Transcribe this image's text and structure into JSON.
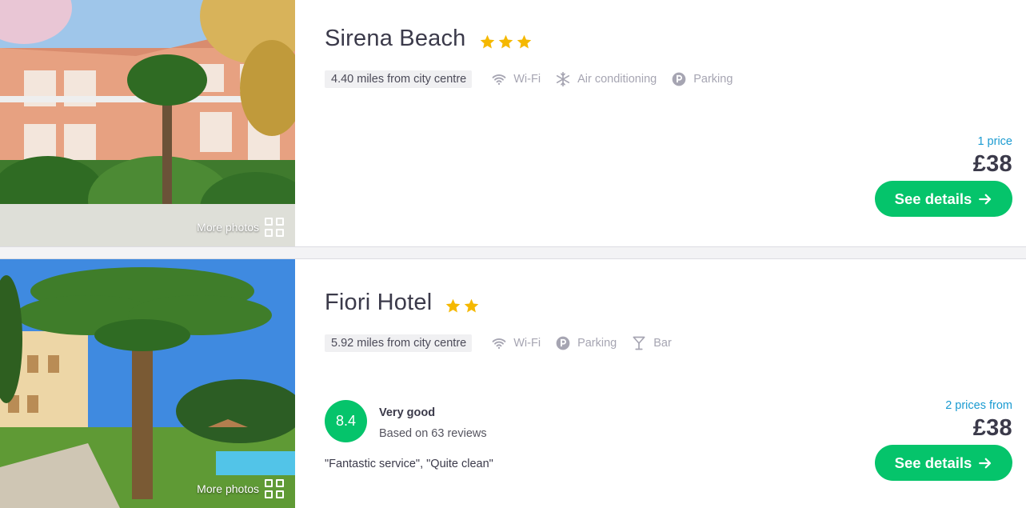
{
  "colors": {
    "accent_green": "#05c46b",
    "star": "#f5b800",
    "link_blue": "#1b9bd1",
    "text_dark": "#3b3a4a",
    "amenity_grey": "#a6a5b2"
  },
  "hotels": [
    {
      "name": "Sirena Beach",
      "stars": 3,
      "distance": "4.40 miles from city centre",
      "amenities": [
        {
          "icon": "wifi-icon",
          "label": "Wi-Fi"
        },
        {
          "icon": "snowflake-icon",
          "label": "Air conditioning"
        },
        {
          "icon": "parking-icon",
          "label": "Parking"
        }
      ],
      "price_note": "1 price",
      "price": "£38",
      "button": "See details",
      "more_photos": "More photos"
    },
    {
      "name": "Fiori Hotel",
      "stars": 2,
      "distance": "5.92 miles from city centre",
      "amenities": [
        {
          "icon": "wifi-icon",
          "label": "Wi-Fi"
        },
        {
          "icon": "parking-icon",
          "label": "Parking"
        },
        {
          "icon": "cocktail-icon",
          "label": "Bar"
        }
      ],
      "price_note": "2 prices from",
      "price": "£38",
      "button": "See details",
      "more_photos": "More photos",
      "rating": {
        "score": "8.4",
        "label": "Very good",
        "reviews": "Based on 63 reviews",
        "quote": "\"Fantastic service\", \"Quite clean\""
      }
    }
  ]
}
